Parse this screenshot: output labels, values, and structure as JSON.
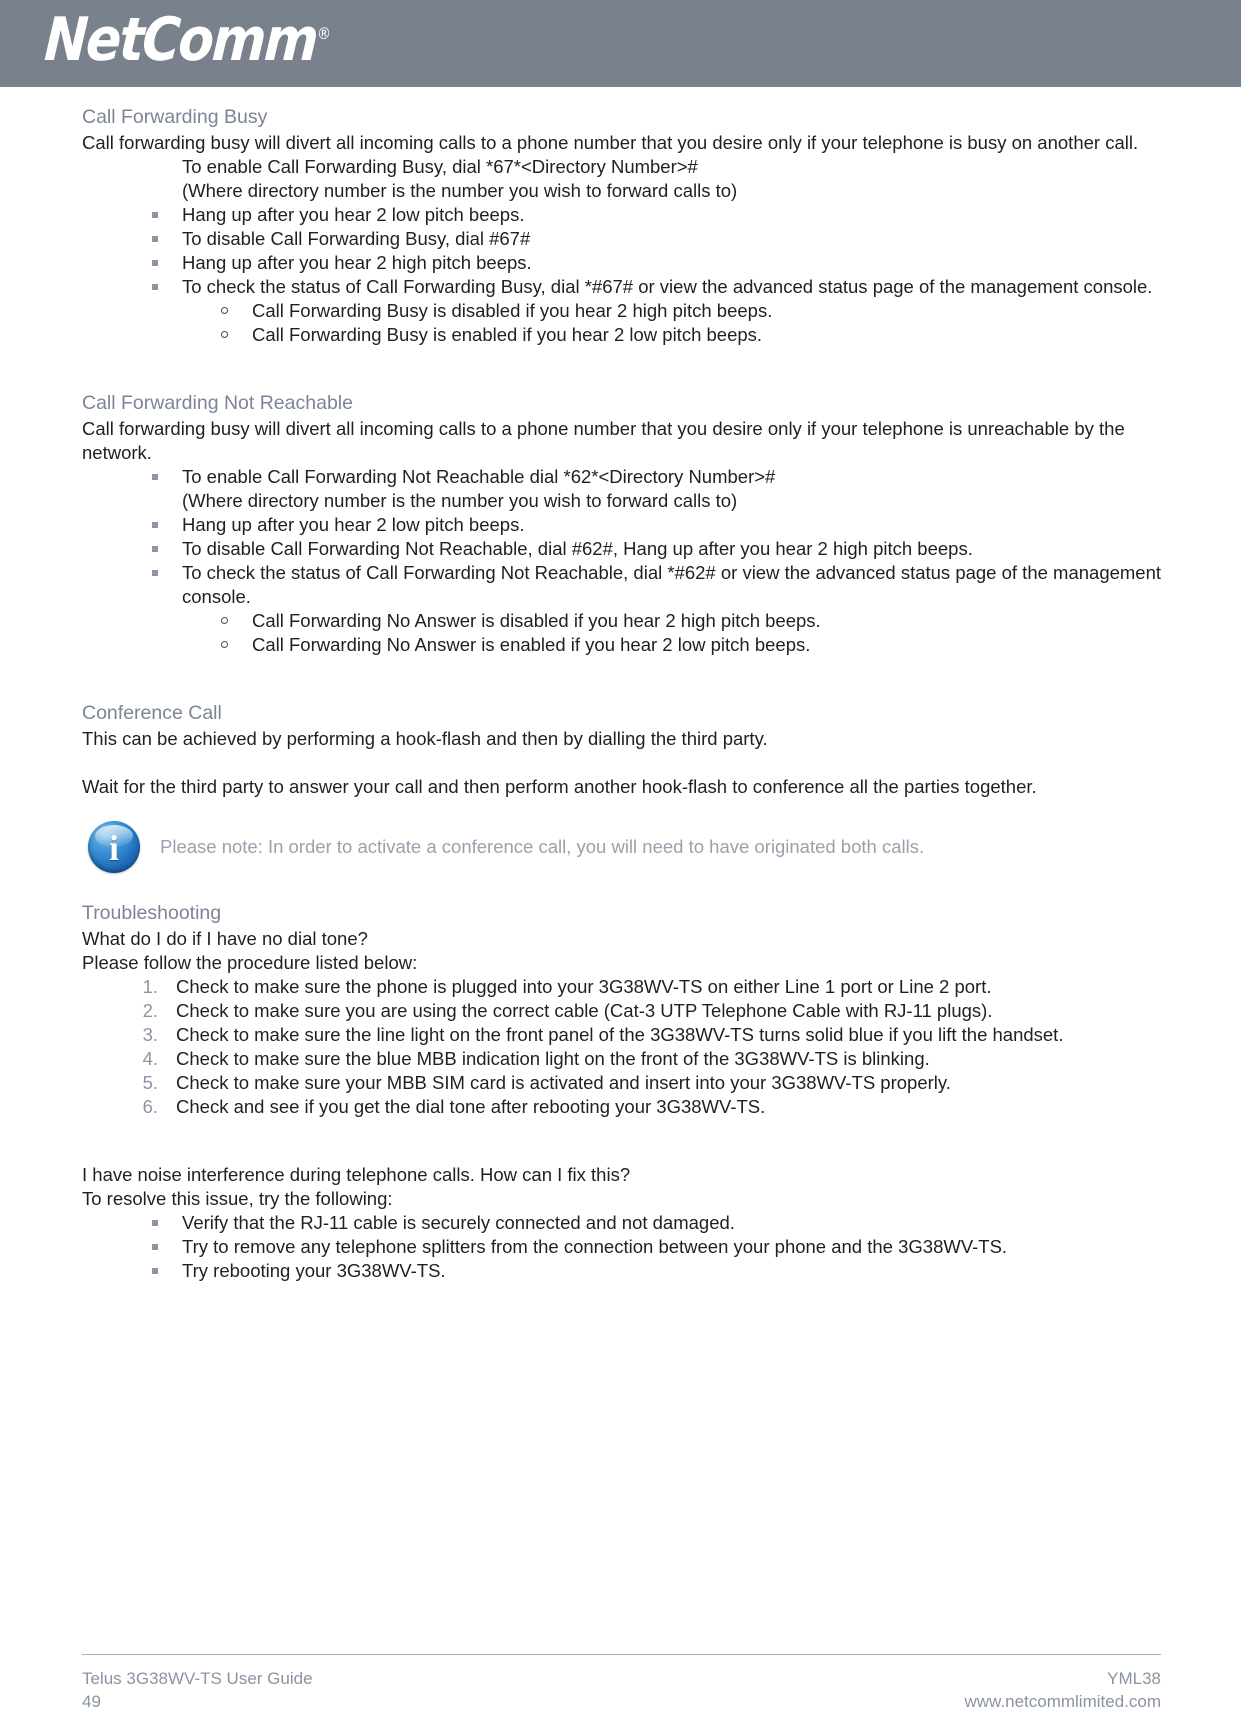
{
  "header": {
    "logo_text": "NetComm",
    "logo_registered": "®",
    "band_color": "#79828c"
  },
  "colors": {
    "heading": "#7c8597",
    "body": "#231f20",
    "note_text": "#9aa1ad",
    "bullet": "#8d95a5",
    "footer_text": "#8a93a4",
    "note_icon_blue": "#1c6cba"
  },
  "sections": {
    "call_forwarding_busy": {
      "heading": "Call Forwarding Busy",
      "intro": "Call forwarding busy will divert all incoming calls to a phone number that you desire only if your telephone is busy on another call.",
      "indented_lines": [
        "To enable Call Forwarding Busy, dial *67*<Directory Number>#",
        "(Where directory number is the number you wish to forward calls to)"
      ],
      "bullets": [
        "Hang up after you hear 2 low pitch beeps.",
        "To disable Call Forwarding Busy, dial #67#",
        "Hang up after you hear 2 high pitch beeps.",
        "To check the status of Call Forwarding Busy, dial *#67# or view the advanced status page of the management console."
      ],
      "sub_bullets": [
        "Call Forwarding Busy is disabled if you hear 2 high pitch beeps.",
        "Call Forwarding Busy is enabled if you hear 2 low pitch beeps."
      ]
    },
    "call_forwarding_not_reachable": {
      "heading": "Call Forwarding Not Reachable",
      "intro": "Call forwarding busy will divert all incoming calls to a phone number that you desire only if your telephone is unreachable by the network.",
      "bullets": [
        "To enable Call Forwarding Not Reachable dial *62*<Directory Number>#",
        "Hang up after you hear 2 low pitch beeps.",
        "To disable Call Forwarding Not Reachable, dial #62#, Hang up after you hear 2 high pitch beeps.",
        "To check the status of Call Forwarding Not Reachable, dial *#62# or view the advanced status page of the management console."
      ],
      "bullet_1_continuation": "(Where directory number is the number you wish to forward calls to)",
      "sub_bullets": [
        "Call Forwarding No Answer is disabled if you hear 2 high pitch beeps.",
        "Call Forwarding No Answer is enabled if you hear 2 low pitch beeps."
      ]
    },
    "conference_call": {
      "heading": "Conference Call",
      "paragraph_1": "This can be achieved by performing a hook-flash and then by dialling the third party.",
      "paragraph_2": "Wait for the third party to answer your call and then perform another hook-flash to conference all the parties together.",
      "note_icon": "info-icon",
      "note": "Please note: In order to activate a conference call, you will need to have originated both calls."
    },
    "troubleshooting": {
      "heading": "Troubleshooting",
      "question_1": "What do I do if I have no dial tone?",
      "lead_1": "Please follow the procedure listed below:",
      "steps": [
        "Check to make sure the phone is plugged into your 3G38WV-TS on either Line 1 port or Line 2 port.",
        "Check to make sure you are using the correct cable (Cat-3 UTP Telephone Cable with RJ-11 plugs).",
        "Check to make sure the line light on the front panel of the 3G38WV-TS turns solid blue if you lift the handset.",
        "Check to make sure the blue MBB indication light on the front of the 3G38WV-TS is blinking.",
        "Check to make sure your MBB SIM card is activated and insert into your 3G38WV-TS properly.",
        "Check and see if you get the dial tone after rebooting your 3G38WV-TS."
      ],
      "question_2": "I have noise interference during telephone calls. How can I fix this?",
      "lead_2": "To resolve this issue, try the following:",
      "fixes": [
        "Verify that the RJ-11 cable is securely connected and not damaged.",
        "Try to remove any telephone splitters from the connection between your phone and the 3G38WV-TS.",
        "Try rebooting your 3G38WV-TS."
      ]
    }
  },
  "footer": {
    "guide_title": "Telus 3G38WV-TS User Guide",
    "page_number": "49",
    "doc_code": "YML38",
    "website": "www.netcommlimited.com"
  }
}
